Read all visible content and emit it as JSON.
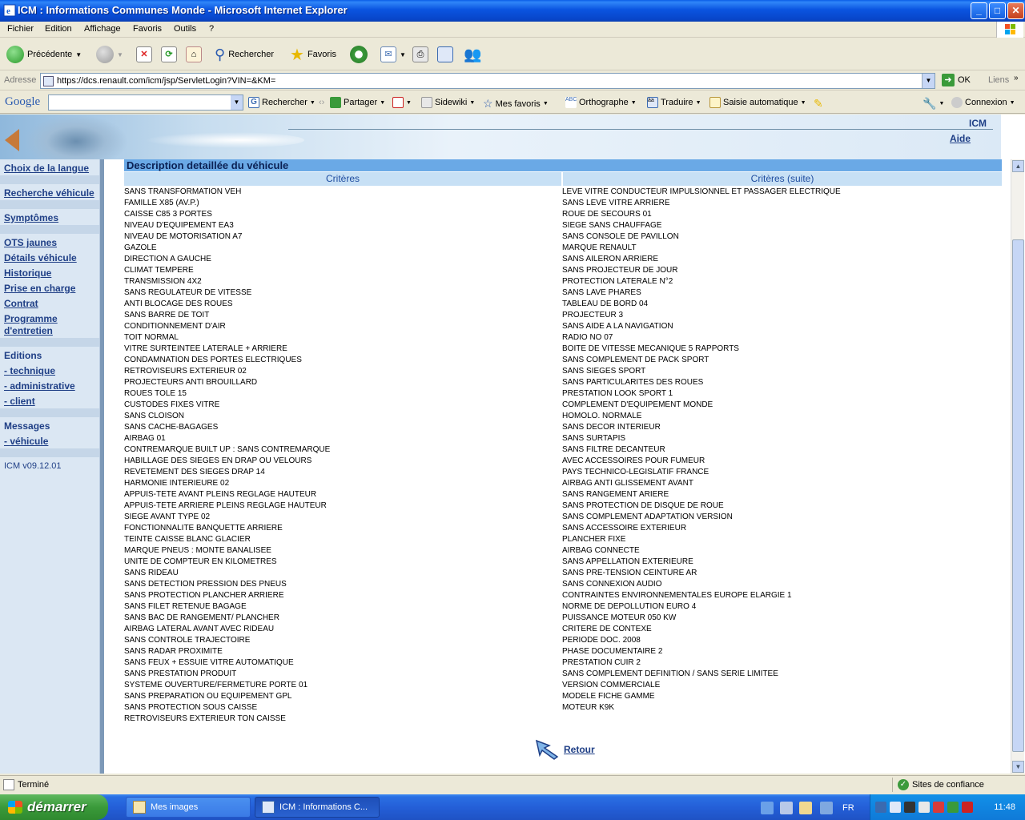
{
  "window": {
    "title": "ICM : Informations Communes Monde - Microsoft Internet Explorer",
    "controls": {
      "minimize": "_",
      "maximize": "□",
      "close": "✕"
    }
  },
  "menubar": [
    "Fichier",
    "Edition",
    "Affichage",
    "Favoris",
    "Outils",
    "?"
  ],
  "toolbar": {
    "back": "Précédente",
    "search": "Rechercher",
    "favorites": "Favoris"
  },
  "address": {
    "label": "Adresse",
    "url": "https://dcs.renault.com/icm/jsp/ServletLogin?VIN=&KM=",
    "go": "OK",
    "links": "Liens"
  },
  "googlebar": {
    "logo": "Google",
    "search_value": "",
    "items": [
      "Rechercher",
      "Partager",
      "Sidewiki",
      "Mes favoris",
      "Orthographe",
      "Traduire",
      "Saisie automatique",
      "Connexion"
    ]
  },
  "banner": {
    "app": "ICM",
    "help": "Aide"
  },
  "sidebar": {
    "links_top": [
      "Choix de la langue",
      "Recherche véhicule",
      "Symptômes"
    ],
    "links_main": [
      "OTS jaunes",
      "Détails véhicule",
      "Historique",
      "Prise en charge",
      "Contrat",
      "Programme\nd'entretien"
    ],
    "editions_heading": "Editions",
    "editions": [
      "technique",
      "administrative",
      "client"
    ],
    "messages_heading": "Messages",
    "messages": [
      "véhicule"
    ],
    "dash": "- ",
    "version": "ICM v09.12.01"
  },
  "content": {
    "title": "Description detaillée du véhicule",
    "col1_header": "Critères",
    "col2_header": "Critères (suite)",
    "col1": [
      "SANS TRANSFORMATION VEH",
      "FAMILLE X85 (AV.P.)",
      "CAISSE C85 3 PORTES",
      "NIVEAU D'EQUIPEMENT EA3",
      "NIVEAU DE MOTORISATION A7",
      "GAZOLE",
      "DIRECTION A GAUCHE",
      "CLIMAT TEMPERE",
      "TRANSMISSION 4X2",
      "SANS REGULATEUR DE VITESSE",
      "ANTI BLOCAGE DES ROUES",
      "SANS BARRE DE TOIT",
      "CONDITIONNEMENT D'AIR",
      "TOIT NORMAL",
      "VITRE SURTEINTEE LATERALE + ARRIERE",
      "CONDAMNATION DES PORTES ELECTRIQUES",
      "RETROVISEURS EXTERIEUR 02",
      "PROJECTEURS ANTI BROUILLARD",
      "ROUES TOLE 15",
      "CUSTODES FIXES VITRE",
      "SANS CLOISON",
      "SANS CACHE-BAGAGES",
      "AIRBAG 01",
      "CONTREMARQUE BUILT UP : SANS CONTREMARQUE",
      "HABILLAGE DES SIEGES EN DRAP OU VELOURS",
      "REVETEMENT DES SIEGES DRAP 14",
      "HARMONIE INTERIEURE 02",
      "APPUIS-TETE AVANT PLEINS REGLAGE HAUTEUR",
      "APPUIS-TETE ARRIERE PLEINS REGLAGE HAUTEUR",
      "SIEGE AVANT TYPE 02",
      "FONCTIONNALITE BANQUETTE ARRIERE",
      "TEINTE CAISSE BLANC GLACIER",
      "MARQUE PNEUS : MONTE BANALISEE",
      "UNITE DE COMPTEUR EN KILOMETRES",
      "SANS RIDEAU",
      "SANS DETECTION PRESSION DES PNEUS",
      "SANS PROTECTION PLANCHER ARRIERE",
      "SANS FILET RETENUE BAGAGE",
      "SANS BAC DE RANGEMENT/ PLANCHER",
      "AIRBAG LATERAL AVANT AVEC RIDEAU",
      "SANS CONTROLE TRAJECTOIRE",
      "SANS RADAR PROXIMITE",
      "SANS FEUX + ESSUIE VITRE AUTOMATIQUE",
      "SANS PRESTATION PRODUIT",
      "SYSTEME OUVERTURE/FERMETURE PORTE 01",
      "SANS PREPARATION OU EQUIPEMENT GPL",
      "SANS PROTECTION SOUS CAISSE",
      "RETROVISEURS EXTERIEUR TON CAISSE"
    ],
    "col2": [
      "LEVE VITRE CONDUCTEUR IMPULSIONNEL ET PASSAGER ELECTRIQUE",
      "SANS LEVE VITRE ARRIERE",
      "ROUE DE SECOURS 01",
      "SIEGE SANS CHAUFFAGE",
      "SANS CONSOLE DE PAVILLON",
      "MARQUE RENAULT",
      "SANS AILERON ARRIERE",
      "SANS PROJECTEUR DE JOUR",
      "PROTECTION LATERALE N°2",
      "SANS LAVE PHARES",
      "TABLEAU DE BORD 04",
      "PROJECTEUR 3",
      "SANS AIDE A LA NAVIGATION",
      "RADIO NO 07",
      "BOITE DE VITESSE MECANIQUE 5 RAPPORTS",
      "SANS COMPLEMENT DE PACK SPORT",
      "SANS SIEGES SPORT",
      "SANS PARTICULARITES DES ROUES",
      "PRESTATION LOOK SPORT 1",
      "COMPLEMENT D'EQUIPEMENT MONDE",
      "HOMOLO. NORMALE",
      "SANS DECOR INTERIEUR",
      "SANS SURTAPIS",
      "SANS FILTRE DECANTEUR",
      "AVEC ACCESSOIRES POUR FUMEUR",
      "PAYS TECHNICO-LEGISLATIF FRANCE",
      "AIRBAG ANTI GLISSEMENT AVANT",
      "SANS RANGEMENT ARIERE",
      "SANS PROTECTION DE DISQUE DE ROUE",
      "SANS COMPLEMENT ADAPTATION VERSION",
      "SANS ACCESSOIRE EXTERIEUR",
      "PLANCHER FIXE",
      "AIRBAG CONNECTE",
      "SANS APPELLATION EXTERIEURE",
      "SANS PRE-TENSION CEINTURE AR",
      "SANS CONNEXION AUDIO",
      "CONTRAINTES ENVIRONNEMENTALES EUROPE ELARGIE 1",
      "NORME DE DEPOLLUTION EURO 4",
      "PUISSANCE MOTEUR 050 KW",
      "CRITERE DE CONTEXE",
      "PERIODE DOC. 2008",
      "PHASE DOCUMENTAIRE 2",
      "PRESTATION CUIR 2",
      "SANS COMPLEMENT DEFINITION / SANS SERIE LIMITEE",
      "VERSION COMMERCIALE",
      "MODELE FICHE GAMME",
      "MOTEUR K9K"
    ],
    "back_link": "Retour"
  },
  "statusbar": {
    "status": "Terminé",
    "zone": "Sites de confiance"
  },
  "taskbar": {
    "start": "démarrer",
    "buttons": [
      "Mes images",
      "ICM : Informations C..."
    ],
    "lang": "FR",
    "clock": "11:48"
  },
  "colors": {
    "link": "#1f3f86",
    "title_bar": "#0a54e0",
    "section_header": "#6aa9e6",
    "column_header": "#c7e0f5",
    "sidebar": "#dbe7f3"
  }
}
